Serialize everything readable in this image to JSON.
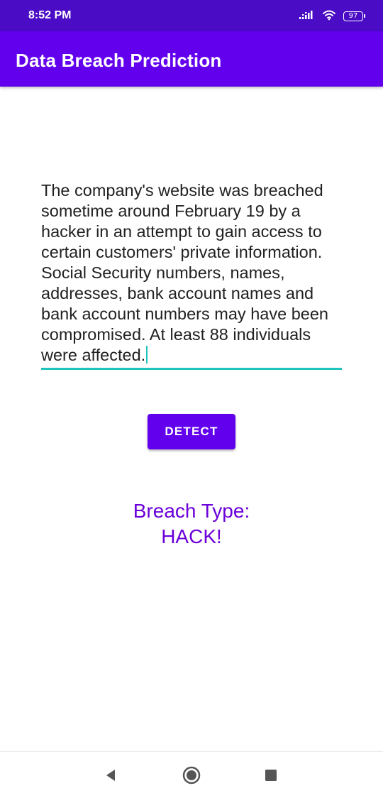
{
  "status_bar": {
    "time": "8:52 PM",
    "battery_level": "97",
    "icons": [
      "signal-icon",
      "wifi-icon",
      "battery-icon"
    ]
  },
  "app_bar": {
    "title": "Data Breach Prediction"
  },
  "input": {
    "value": "The company's website was breached sometime around February 19 by a hacker in an attempt to gain access to certain customers' private information. Social Security numbers, names, addresses, bank account names and bank account numbers may have been compromised. At least 88 individuals were affected."
  },
  "detect_button": {
    "label": "DETECT"
  },
  "result": {
    "label": "Breach Type:",
    "value": "HACK!"
  },
  "nav_bar": {
    "buttons": [
      "back-icon",
      "home-icon",
      "recents-icon"
    ]
  },
  "colors": {
    "status_bar": "#4a0cc4",
    "app_bar": "#6200ee",
    "accent": "#1fc3bd",
    "result_text": "#6b00d8"
  }
}
